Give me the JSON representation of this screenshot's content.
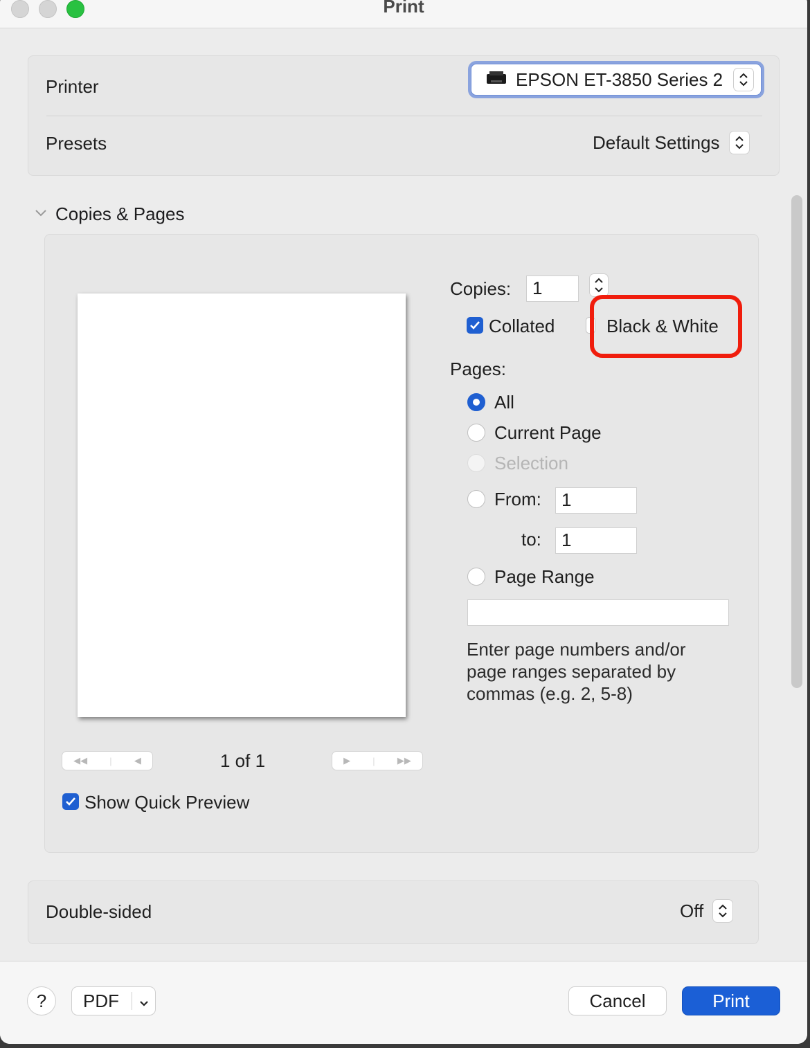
{
  "window": {
    "title": "Print"
  },
  "printer": {
    "label": "Printer",
    "value": "EPSON ET-3850 Series 2"
  },
  "presets": {
    "label": "Presets",
    "value": "Default Settings"
  },
  "section": {
    "title": "Copies & Pages"
  },
  "copies": {
    "label": "Copies:",
    "value": "1"
  },
  "collated": {
    "label": "Collated",
    "checked": true
  },
  "black_white": {
    "label": "Black & White",
    "checked": false
  },
  "pages": {
    "label": "Pages:",
    "options": [
      "All",
      "Current Page",
      "Selection",
      "From:",
      "Page Range"
    ],
    "selected": "All",
    "from_value": "1",
    "to_label": "to:",
    "to_value": "1",
    "range_value": "",
    "hint": "Enter page numbers and/or page ranges separated by commas (e.g. 2, 5-8)"
  },
  "preview": {
    "page_indicator": "1 of 1",
    "show_quick_preview": "Show Quick Preview",
    "show_quick_preview_checked": true
  },
  "double_sided": {
    "label": "Double-sided",
    "value": "Off"
  },
  "footer": {
    "help": "?",
    "pdf": "PDF",
    "cancel": "Cancel",
    "print": "Print"
  },
  "colors": {
    "accent": "#1f5fd1",
    "highlight": "#f01d0d"
  }
}
